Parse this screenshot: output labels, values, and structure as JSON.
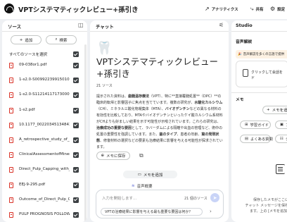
{
  "header": {
    "title": "VPTシステマティックレビュー+孫引き",
    "analytics_label": "アナリティクス",
    "share_label": "共有",
    "settings_label": "設定"
  },
  "sources": {
    "title": "ソース",
    "add_label": "追加",
    "search_label": "検索",
    "select_all_label": "すべてのソースを選択",
    "items": [
      "09-038or1.pdf",
      "1-s2.0-S00992239915010787...",
      "1-s2.0-S1121411717300092-...",
      "1-s2.pdf",
      "10.1177_0022034513484336...",
      "A_retrospective_study_of_i...",
      "ClinicalAssessmentofMineral...",
      "Direct_Pulp_Capping_with_C...",
      "EEJ-9-295.pdf",
      "Outcome_of_Direct_Pulp_Ca...",
      "PULP PROGNOSIS FOLLOWI..."
    ]
  },
  "chat": {
    "title": "チャット",
    "note_emoji": "🦷",
    "note_title": "VPTシステマティックレビュー+孫引き",
    "source_count": "21 ソース",
    "summary": [
      {
        "t": "提示された資料は、"
      },
      {
        "t": "歯髄温存療法",
        "b": true
      },
      {
        "t": "（VPT）、特に**直接覆髄処置**（DPC）**の臨床的転帰と影響因子に焦点を当てています。複数の研究が、"
      },
      {
        "t": "水酸化カルシウム",
        "b": true
      },
      {
        "t": "（CH）、ミネラル三酸化物凝集体（MTA）、"
      },
      {
        "t": "バイオデンチン",
        "b": true
      },
      {
        "t": "などの異なる材料の有効性を比較しており、MTAやバイオデンチンといったケイ酸カルシウム系材料がCHよりも好ましい結果を示す可能性が示唆されています。これらの研究は、"
      },
      {
        "t": "治療成功の重要な要因",
        "b": true
      },
      {
        "t": "として、ラバーダムによる隔離や出血の管理など、術中の処置の重要性を強調しています。また、"
      },
      {
        "t": "歯のタイプ",
        "b": true
      },
      {
        "t": "、患者の年齢、"
      },
      {
        "t": "窩の発現状態",
        "b": true
      },
      {
        "t": "、修復材料の選択などの要素も治療結果に影響を与える可能性が探求されています。"
      }
    ],
    "save_memo_label": "メモに保存",
    "add_memo_label": "メモを追加",
    "audio_overview_label": "音声概要",
    "input_placeholder": "入力を開始します...",
    "input_source_count": "21 個のソース",
    "suggestion": "VPTの治療結果に影響を与える最も重要な要因は何か？"
  },
  "studio": {
    "title": "Studio",
    "audio_section": "音声解説",
    "banner_text": "音声解説を多くの言語で提供",
    "audio_card_text": [
      "クリックして会話を",
      "ド"
    ],
    "memo_section": "メモ",
    "add_note_label": "メモを追加",
    "chips": [
      "学習ガイド",
      "よくある質問",
      "ブリ",
      "タ"
    ],
    "empty_text": [
      "保存したメモがここに",
      "チャット メッセージを保存",
      "ます。上の [メモを追加]"
    ]
  }
}
